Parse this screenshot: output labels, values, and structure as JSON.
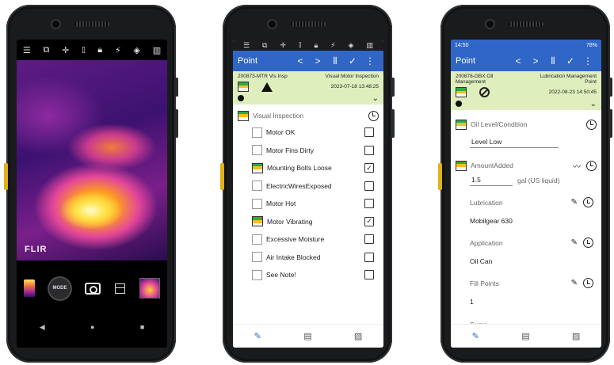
{
  "phone1": {
    "toolbar_icons": [
      "menu-icon",
      "copy-icon",
      "crosshair-icon",
      "thermometer-icon",
      "lock-icon",
      "no-flash-icon",
      "gallery-icon",
      "barcode-icon"
    ],
    "logo": "FLIR",
    "mode_label": "MODE",
    "nav": [
      "◀",
      "●",
      "■"
    ]
  },
  "phone2": {
    "appbar_title": "Point",
    "asset_id": "200873-MTR Vis Insp",
    "route_name": "Visual Motor Inspection",
    "timestamp": "2023-07-18 13:48:25",
    "section_label": "Visual Inspection",
    "items": [
      {
        "label": "Motor OK",
        "checked": false,
        "tag": false
      },
      {
        "label": "Motor Fins Dirty",
        "checked": false,
        "tag": false
      },
      {
        "label": "Mounting Bolts Loose",
        "checked": true,
        "tag": true
      },
      {
        "label": "ElectricWiresExposed",
        "checked": false,
        "tag": false
      },
      {
        "label": "Motor Hot",
        "checked": false,
        "tag": false
      },
      {
        "label": "Motor Vibrating",
        "checked": true,
        "tag": true
      },
      {
        "label": "Excessive Moisture",
        "checked": false,
        "tag": false
      },
      {
        "label": "Air Intake Blocked",
        "checked": false,
        "tag": false
      },
      {
        "label": "See Note!",
        "checked": false,
        "tag": false
      }
    ]
  },
  "phone3": {
    "status_time": "14:50",
    "status_battery": "78%",
    "appbar_title": "Point",
    "asset_id": "200878-GBX Oil Management",
    "route_name": "Lubrication Management Point",
    "timestamp": "2022-08-23 14:50:45",
    "oil_label": "Oil Level/Condition",
    "oil_value": "Level Low",
    "amount_label": "AmountAdded",
    "amount_value": "1.5",
    "amount_unit": "gal (US liquid)",
    "lubrication_label": "Lubrication",
    "lubrication_value": "Mobilgear 630",
    "application_label": "Application",
    "application_value": "Oil Can",
    "fill_label": "Fill Points",
    "fill_value": "1",
    "next_label": "Sump"
  },
  "colors": {
    "brand": "#2f66c8",
    "info_bg": "#dfeebd",
    "device": "#1a1b1d"
  }
}
